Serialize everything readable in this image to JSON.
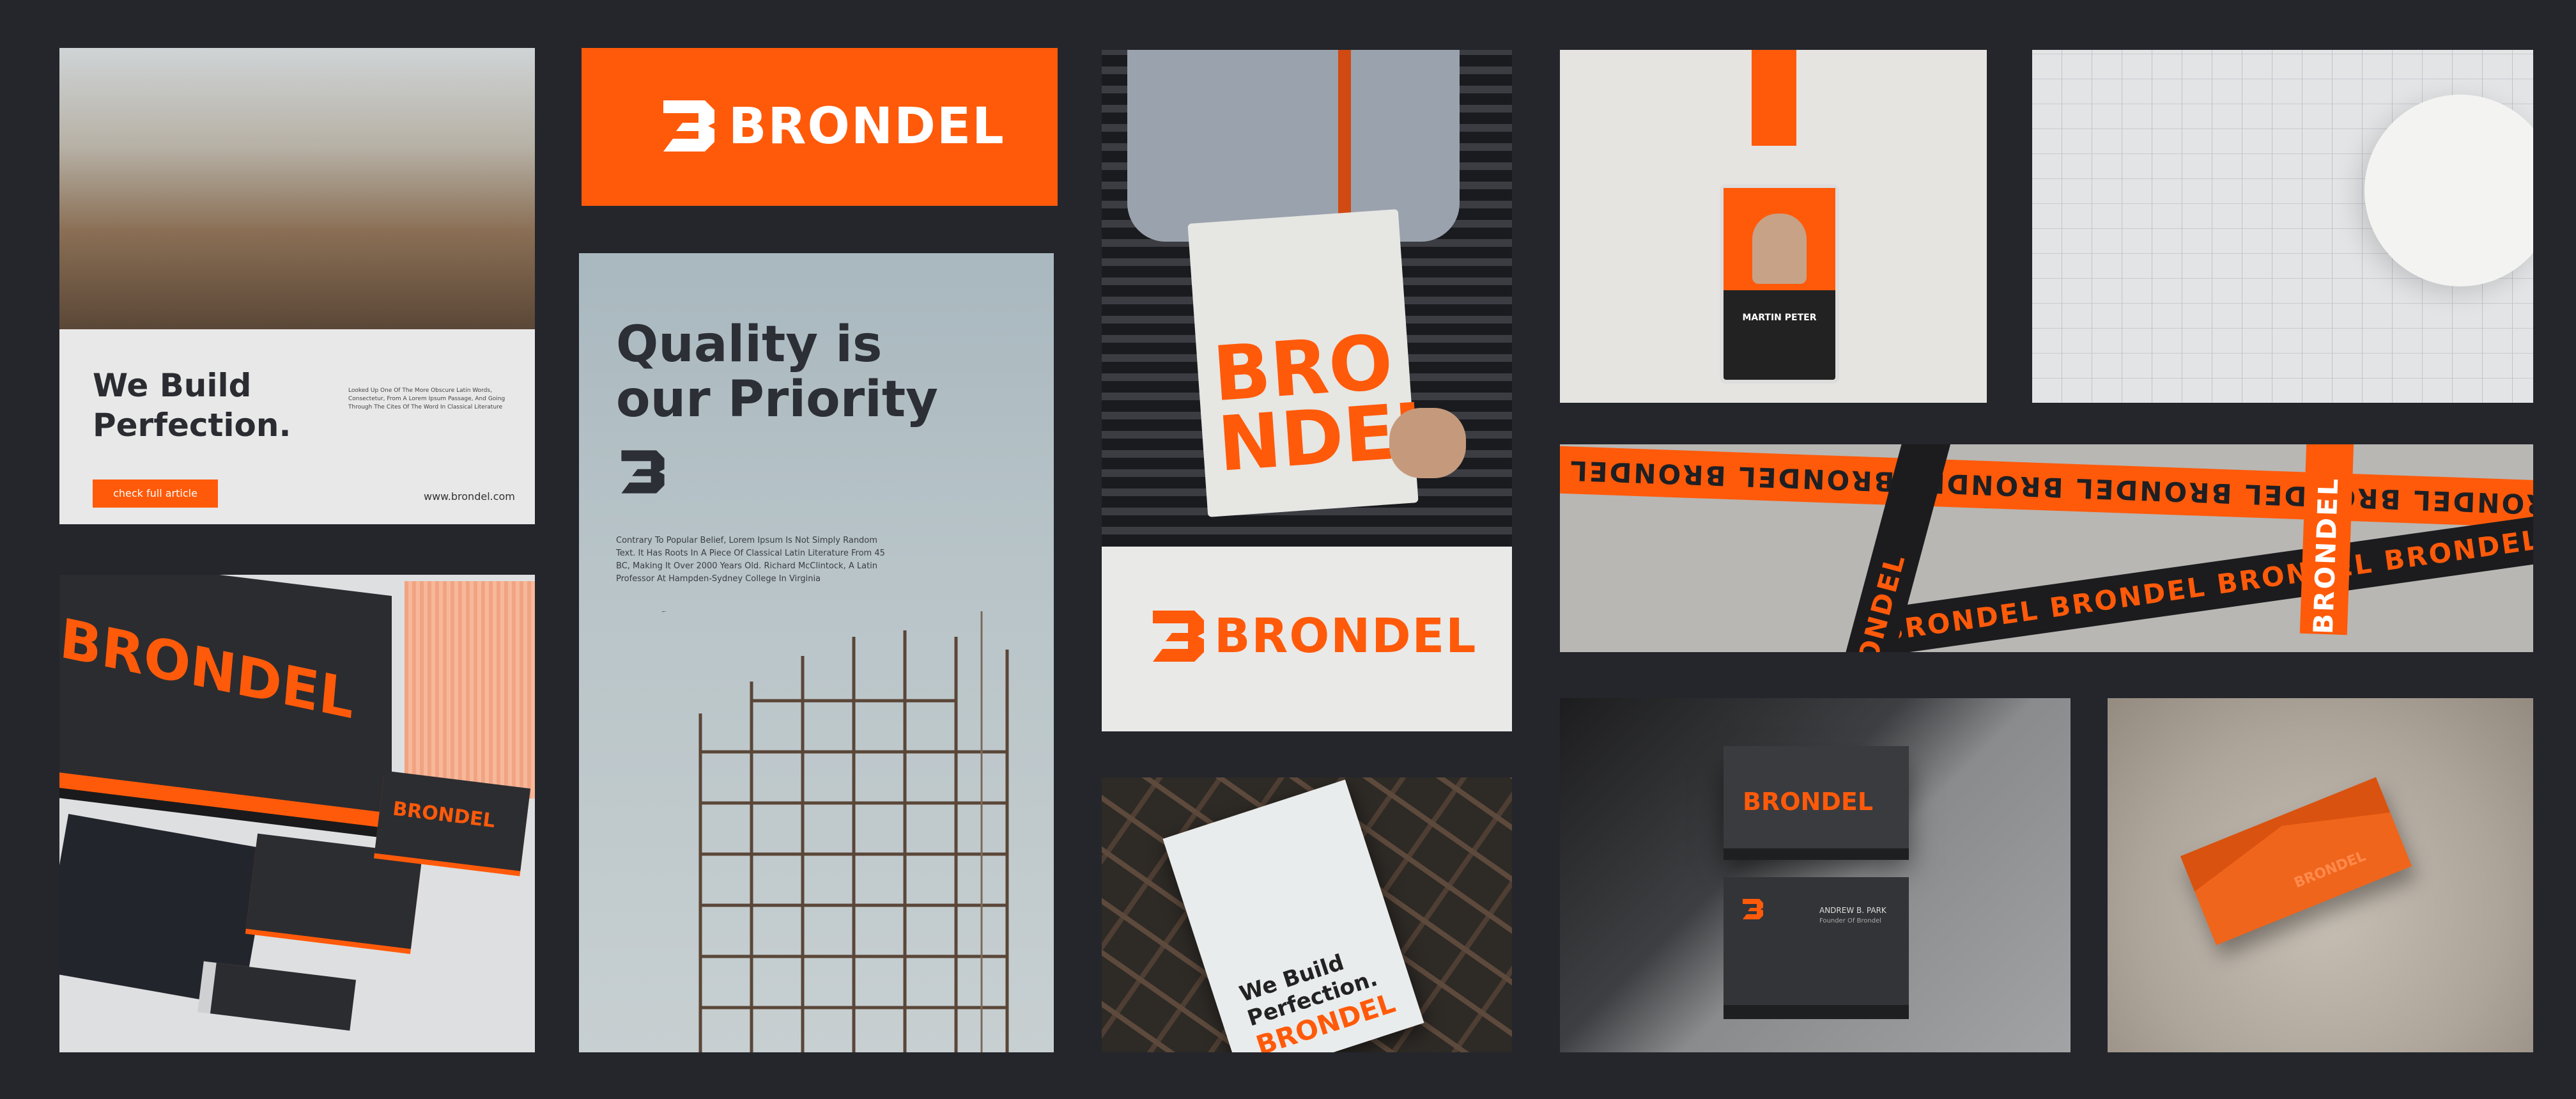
{
  "brand": {
    "wordmark": "BRONDEL",
    "accent": "#ff5a0a",
    "dark": "#24262c"
  },
  "card_we_build": {
    "headline": "We Build\nPerfection.",
    "body": "Looked Up One Of The More Obscure Latin Words, Consectetur, From A Lorem Ipsum Passage, And Going Through The Cites Of The Word In Classical Literature",
    "button": "check full article",
    "url": "www.brondel.com"
  },
  "poster_quality": {
    "title": "Quality is\nour Priority",
    "paragraph": "Contrary To Popular Belief, Lorem Ipsum Is Not Simply Random Text. It Has Roots In A Piece Of Classical Latin Literature From 45 BC, Making It Over 2000 Years Old. Richard McClintock, A Latin Professor At Hampden-Sydney College In Virginia"
  },
  "tote": {
    "text": "BRO\nNDEL"
  },
  "id_card": {
    "name": "MARTIN PETER"
  },
  "rebar_poster": {
    "text": "We Build\nPerfection."
  },
  "ribbons": {
    "text": "BRONDEL  BRONDEL  BRONDEL  BRONDEL  BRONDEL  BRONDEL"
  },
  "business_card": {
    "name": "ANDREW B. PARK",
    "role": "Founder Of Brondel"
  }
}
